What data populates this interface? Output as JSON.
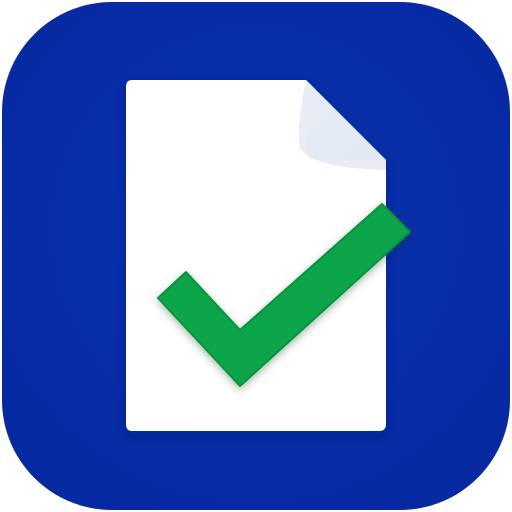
{
  "icon": {
    "semantic": "document-checkmark-app-icon",
    "colors": {
      "background": "#0a33b0",
      "background_edge": "#0628a0",
      "page": "#ffffff",
      "page_shadow": "#e9edf5",
      "fold": "#dfe6f2",
      "fold_shadow": "#c8d2e3",
      "check": "#0aa54a",
      "check_edge": "#07913f"
    }
  }
}
